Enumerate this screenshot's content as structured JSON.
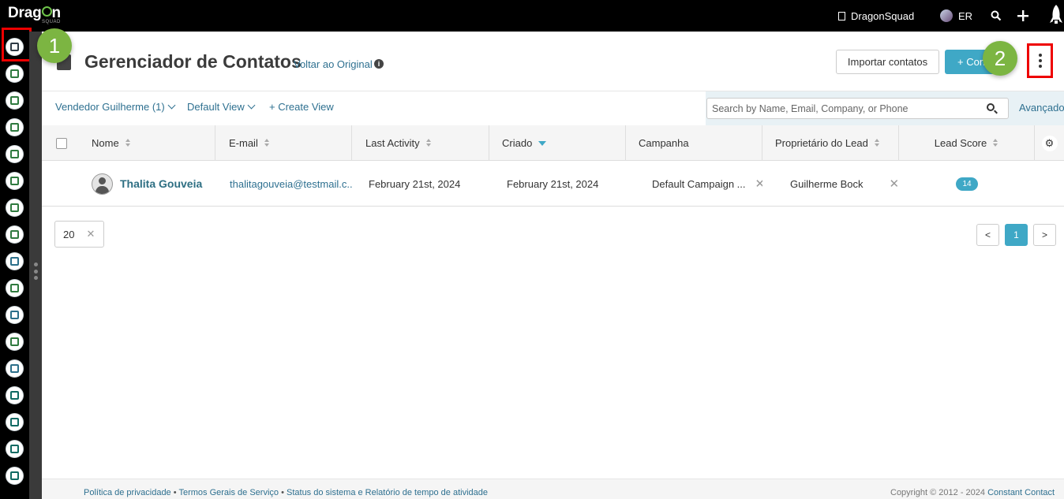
{
  "topbar": {
    "logo": "Drag",
    "logo_o": "o",
    "logo_end": "n",
    "logo_sub": "SQUAD",
    "org": "DragonSquad",
    "user_initials": "ER"
  },
  "callouts": {
    "one": "1",
    "two": "2"
  },
  "header": {
    "title": "Gerenciador de Contatos",
    "revert_link": "Voltar ao Original",
    "info_glyph": "i",
    "import_button": "Importar contatos",
    "add_button": "+ Con"
  },
  "filters": {
    "owner": "Vendedor Guilherme  (1)",
    "view": "Default View",
    "create_view": "+ Create View",
    "search_placeholder": "Search by Name, Email, Company, or Phone",
    "advanced": "Avançado"
  },
  "table": {
    "columns": [
      "Nome",
      "E-mail",
      "Last Activity",
      "Criado",
      "Campanha",
      "Proprietário do Lead",
      "Lead Score"
    ],
    "rows": [
      {
        "name": "Thalita Gouveia",
        "email": "thalitagouveia@testmail.c...",
        "last_activity": "February 21st, 2024",
        "created": "February 21st, 2024",
        "campaign": "Default Campaign ...",
        "owner": "Guilherme Bock",
        "score": "14"
      }
    ]
  },
  "pagination": {
    "per_page": "20",
    "prev": "<",
    "current": "1",
    "next": ">"
  },
  "footer": {
    "privacy": "Política de privacidade",
    "terms": "Termos Gerais de Serviço",
    "status": "Status do sistema e Relatório de tempo de atividade",
    "copyright": "Copyright © 2012 - 2024",
    "company": "Constant Contact"
  },
  "colors": {
    "accent": "#3fa8c6",
    "link": "#2e7090",
    "callout": "#7cb542",
    "highlight": "#e00000"
  }
}
